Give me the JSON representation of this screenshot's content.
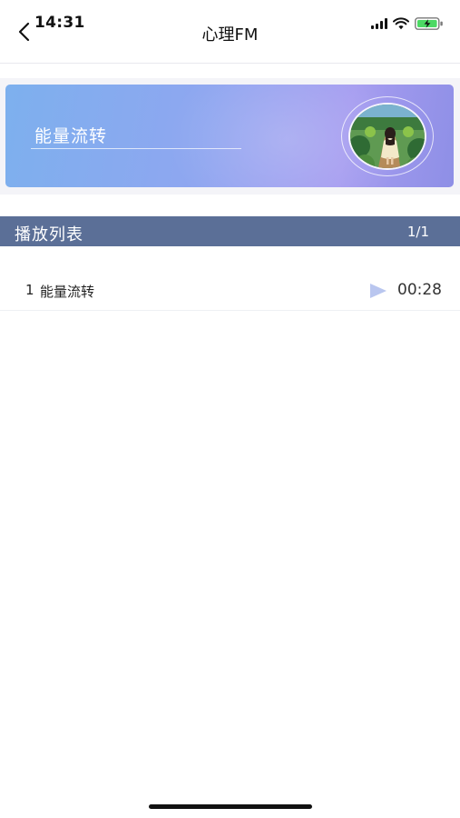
{
  "status_bar": {
    "time": "14:31"
  },
  "nav": {
    "title": "心理FM",
    "back_icon": "chevron-left-icon"
  },
  "banner": {
    "title": "能量流转",
    "cover_image": "girl-in-garden-illustration"
  },
  "playlist": {
    "title": "播放列表",
    "count": "1/1",
    "tracks": [
      {
        "index": "1",
        "name": "能量流转",
        "duration": "00:28",
        "icon": "play-icon"
      }
    ]
  },
  "colors": {
    "playlist_header_bg": "#5b6f97",
    "banner_gradient_start": "#7db0ee",
    "banner_gradient_end": "#a59cf0",
    "play_icon": "#b9c6ef",
    "battery_fill": "#4cd964"
  }
}
